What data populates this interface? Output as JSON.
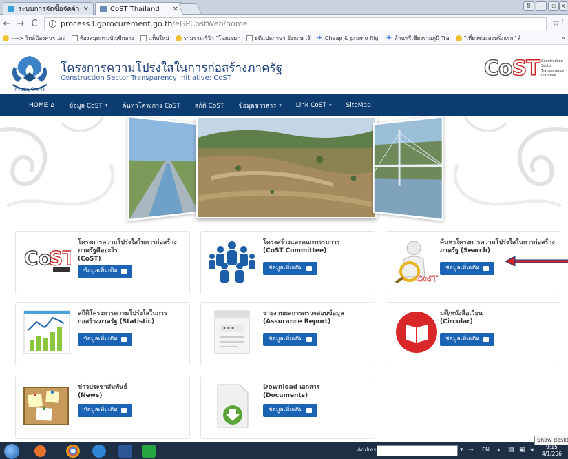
{
  "browser": {
    "tabs": [
      {
        "label": "ระบบการจัดซื้อจัดจ้างภาครัฐ",
        "favicon_color": "#3aa0d8"
      },
      {
        "label": "CoST Thailand",
        "favicon_color": "#6b8bb8"
      }
    ],
    "window_controls": [
      "minimize",
      "restore",
      "close"
    ],
    "url_host": "process3.gprocurement.go.th",
    "url_path": "/eGPCostWeb/home",
    "bookmarks": [
      {
        "label": "----> ไทล์น้องคนร..ละ",
        "icon": "smiley-icon"
      },
      {
        "label": "ห้องสมุดกรมบัญชีกลาง",
        "icon": "page-icon"
      },
      {
        "label": "แท็บใหม่",
        "icon": "page-icon"
      },
      {
        "label": "รามราม-ริริว \"โรงแรมก",
        "icon": "smiley-icon"
      },
      {
        "label": "ยุติแปลภาษา อังกฤษ เจ้",
        "icon": "page-icon"
      },
      {
        "label": "Cheap & promo fligi",
        "icon": "plane-icon"
      },
      {
        "label": "ด้านพรีเชียงรายภูมิ Tra",
        "icon": "plane-icon"
      },
      {
        "label": "\"เที่ยวช่องสะพรั่งแรก\" ส์",
        "icon": "smiley-icon"
      }
    ],
    "bookmarks_more": "»"
  },
  "site": {
    "title": "โครงการความโปร่งใสในการก่อสร้างภาครัฐ",
    "subtitle": "Construction Sector Transparency Initiative: CoST",
    "emblem_text": "กรมบัญชีกลาง",
    "cost_logo_word": "CoST",
    "cost_logo_side": "Construction Sector Transparency Initiative"
  },
  "nav": [
    {
      "label": "HOME",
      "icon": "home-icon",
      "dropdown": false
    },
    {
      "label": "ข้อมูล CoST",
      "dropdown": true
    },
    {
      "label": "ค้นหาโครงการ CoST",
      "dropdown": false
    },
    {
      "label": "สถิติ CoST",
      "dropdown": false
    },
    {
      "label": "ข้อมูลข่าวสาร",
      "dropdown": true
    },
    {
      "label": "Link CoST",
      "dropdown": true
    },
    {
      "label": "SiteMap",
      "dropdown": false
    }
  ],
  "cards": [
    {
      "line1": "โครงการความโปร่งใสในการก่อสร้าง",
      "line2": "ภาครัฐคืออะไร",
      "line3": "(CoST)",
      "button": "ข้อมูลเพิ่มเติม",
      "icon": "cost-logo-icon"
    },
    {
      "line1": "โครงสร้างและคณะกรรมการ",
      "line2": "(CoST Committee)",
      "line3": "",
      "button": "ข้อมูลเพิ่มเติม",
      "icon": "committee-icon"
    },
    {
      "line1": "ค้นหาโครงการความโปร่งใสในการก่อสร้าง",
      "line2": "ภาครัฐ (Search)",
      "line3": "",
      "button": "ข้อมูลเพิ่มเติม",
      "icon": "search-person-icon"
    },
    {
      "line1": "สถิติโครงการความโปร่งใสในการ",
      "line2": "ก่อสร้างภาครัฐ (Statistic)",
      "line3": "",
      "button": "ข้อมูลเพิ่มเติม",
      "icon": "statistic-chart-icon"
    },
    {
      "line1": "รายงานผลการตรวจสอบข้อมูล",
      "line2": "(Assurance Report)",
      "line3": "",
      "button": "ข้อมูลเพิ่มเติม",
      "icon": "report-document-icon"
    },
    {
      "line1": "มติ/หนังสือเวียน",
      "line2": "(Circular)",
      "line3": "",
      "button": "ข้อมูลเพิ่มเติม",
      "icon": "book-icon"
    },
    {
      "line1": "ข่าวประชาสัมพันธ์",
      "line2": "(News)",
      "line3": "",
      "button": "ข้อมูลเพิ่มเติม",
      "icon": "news-board-icon"
    },
    {
      "line1": "Download เอกสาร",
      "line2": "(Documents)",
      "line3": "",
      "button": "ข้อมูลเพิ่มเติม",
      "icon": "download-document-icon"
    }
  ],
  "taskbar": {
    "address_label": "Address",
    "lang": "EN",
    "time": "9:15",
    "date": "4/1/256",
    "tooltip": "Show deskto"
  },
  "colors": {
    "nav_bg": "#0d3d70",
    "button_bg": "#1a63b5",
    "title_blue": "#1d3f7a"
  }
}
